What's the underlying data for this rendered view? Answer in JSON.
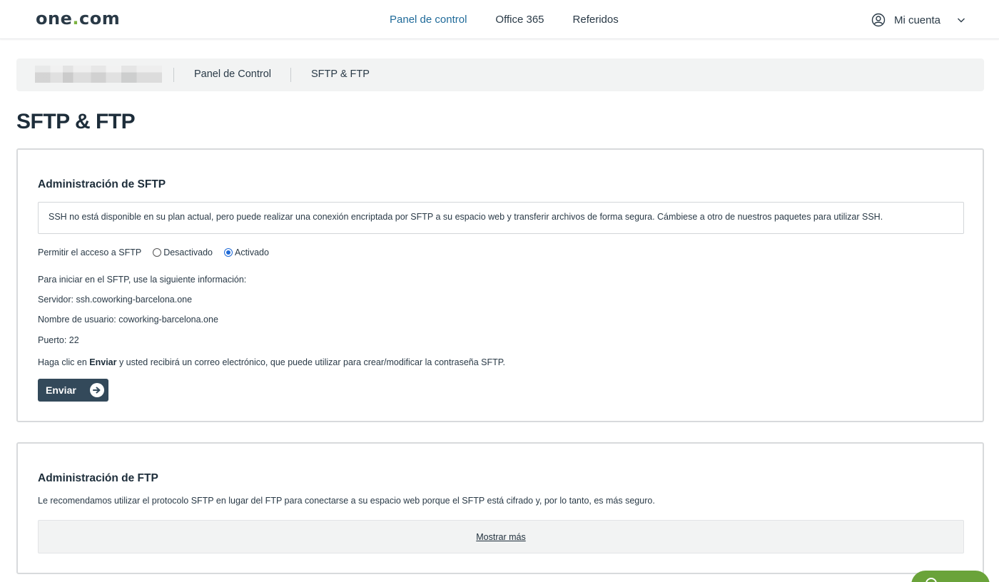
{
  "header": {
    "logo_main": "one",
    "logo_dot": ".",
    "logo_tld": "com",
    "nav": [
      {
        "label": "Panel de control",
        "active": true
      },
      {
        "label": "Office 365",
        "active": false
      },
      {
        "label": "Referidos",
        "active": false
      }
    ],
    "account_label": "Mi cuenta"
  },
  "breadcrumb": {
    "items": [
      "Panel de Control",
      "SFTP & FTP"
    ]
  },
  "page_title": "SFTP & FTP",
  "sftp": {
    "heading": "Administración de SFTP",
    "notice": "SSH no está disponible en su plan actual, pero puede realizar una conexión encriptada por SFTP a su espacio web y transferir archivos de forma segura. Cámbiese a otro de nuestros paquetes para utilizar SSH.",
    "access_label": "Permitir el acceso a SFTP",
    "options": [
      {
        "label": "Desactivado",
        "checked": false
      },
      {
        "label": "Activado",
        "checked": true
      }
    ],
    "intro": "Para iniciar en el SFTP, use la siguiente información:",
    "server": "Servidor: ssh.coworking-barcelona.one",
    "username": "Nombre de usuario: coworking-barcelona.one",
    "port": "Puerto: 22",
    "instruction_pre": "Haga clic en ",
    "instruction_bold": "Enviar",
    "instruction_post": " y usted recibirá un correo electrónico, que puede utilizar para crear/modificar la contraseña SFTP.",
    "send_button": "Enviar"
  },
  "ftp": {
    "heading": "Administración de FTP",
    "description": "Le recomendamos utilizar el protocolo SFTP en lugar del FTP para conectarse a su espacio web porque el SFTP está cifrado y, por lo tanto, es más seguro.",
    "show_more": "Mostrar más"
  },
  "colors": {
    "accent": "#1f6a99",
    "button": "#33495a",
    "logo_dot": "#7cb342",
    "chat": "#6aa33a"
  }
}
